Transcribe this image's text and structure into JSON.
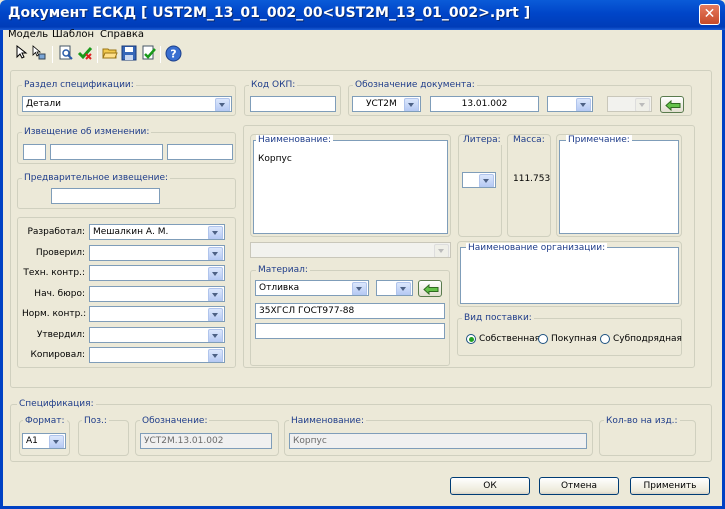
{
  "window": {
    "title": "Документ ЕСКД [ UST2M_13_01_002_00<UST2M_13_01_002>.prt ]",
    "close_glyph": "✕"
  },
  "menu": [
    "Модель",
    "Шаблон",
    "Справка"
  ],
  "toolbar": {
    "buttons": [
      "pointer-icon",
      "select-tree-icon",
      "preview-icon",
      "check-icon",
      "open-folder-icon",
      "save-icon",
      "save-check-icon",
      "help-icon"
    ]
  },
  "section": {
    "label": "Раздел спецификации:",
    "value": "Детали"
  },
  "okp": {
    "label": "Код ОКП:",
    "value": ""
  },
  "designation": {
    "label": "Обозначение документа:",
    "prefix": "УСТ2М",
    "number": "13.01.002",
    "suffix": "",
    "extra": ""
  },
  "change_notice": {
    "label": "Извещение об изменении:",
    "field1": "",
    "field2": "",
    "field3": ""
  },
  "preliminary_notice": {
    "label": "Предварительное извещение:",
    "value": ""
  },
  "signatures": [
    {
      "label": "Разработал:",
      "value": "Мешалкин А. М."
    },
    {
      "label": "Проверил:",
      "value": ""
    },
    {
      "label": "Техн. контр.:",
      "value": ""
    },
    {
      "label": "Нач. бюро:",
      "value": ""
    },
    {
      "label": "Норм. контр.:",
      "value": ""
    },
    {
      "label": "Утвердил:",
      "value": ""
    },
    {
      "label": "Копировал:",
      "value": ""
    }
  ],
  "name": {
    "label": "Наименование:",
    "value": "Корпус"
  },
  "litera": {
    "label": "Литера:",
    "value": ""
  },
  "mass": {
    "label": "Масса:",
    "value": "111.753"
  },
  "note": {
    "label": "Примечание:",
    "value": ""
  },
  "org": {
    "label": "Наименование организации:",
    "value": ""
  },
  "material": {
    "label": "Материал:",
    "type": "Отливка",
    "type2": "",
    "grade": "35ХГСЛ ГОСТ977-88",
    "extra": ""
  },
  "supply": {
    "label": "Вид поставки:",
    "options": [
      "Собственная",
      "Покупная",
      "Субподрядная"
    ],
    "selected": "Собственная"
  },
  "spec": {
    "label": "Спецификация:",
    "format_label": "Формат:",
    "format_value": "A1",
    "pos_label": "Поз.:",
    "designation_label": "Обозначение:",
    "designation_value": "УСТ2М.13.01.002",
    "name_label": "Наименование:",
    "name_value": "Корпус",
    "qty_label": "Кол-во на изд.:"
  },
  "buttons": {
    "ok": "ОК",
    "cancel": "Отмена",
    "apply": "Применить"
  }
}
